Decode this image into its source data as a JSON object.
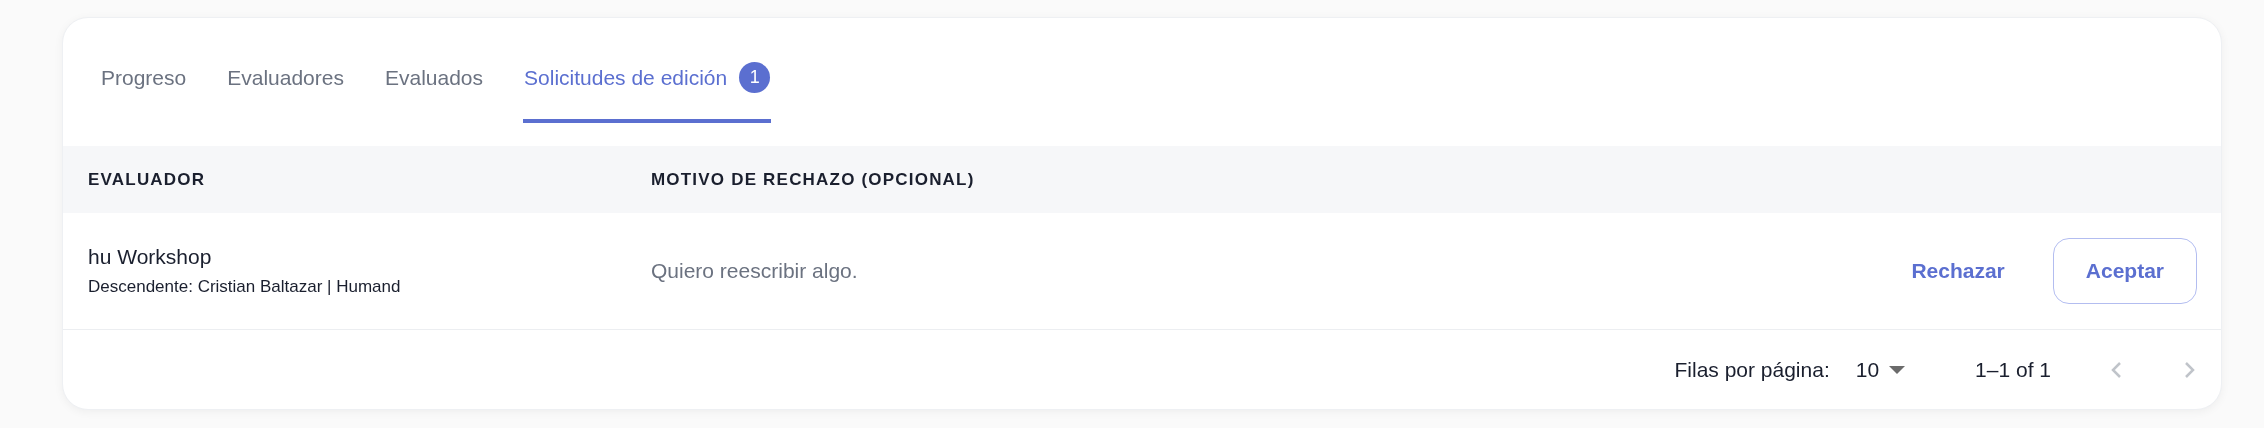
{
  "tabs": [
    {
      "label": "Progreso",
      "selected": false
    },
    {
      "label": "Evaluadores",
      "selected": false
    },
    {
      "label": "Evaluados",
      "selected": false
    },
    {
      "label": "Solicitudes de edición",
      "selected": true,
      "badge": "1"
    }
  ],
  "table": {
    "columns": [
      "EVALUADOR",
      "MOTIVO DE RECHAZO (OPCIONAL)"
    ],
    "rows": [
      {
        "name": "hu Workshop",
        "detail": "Descendente: Cristian Baltazar | Humand",
        "reason": "Quiero reescribir algo.",
        "reject": "Rechazar",
        "accept": "Aceptar"
      }
    ]
  },
  "pagination": {
    "rows_label": "Filas por página:",
    "rows_value": "10",
    "range": "1–1 of 1",
    "prev_disabled": true,
    "next_disabled": true
  }
}
